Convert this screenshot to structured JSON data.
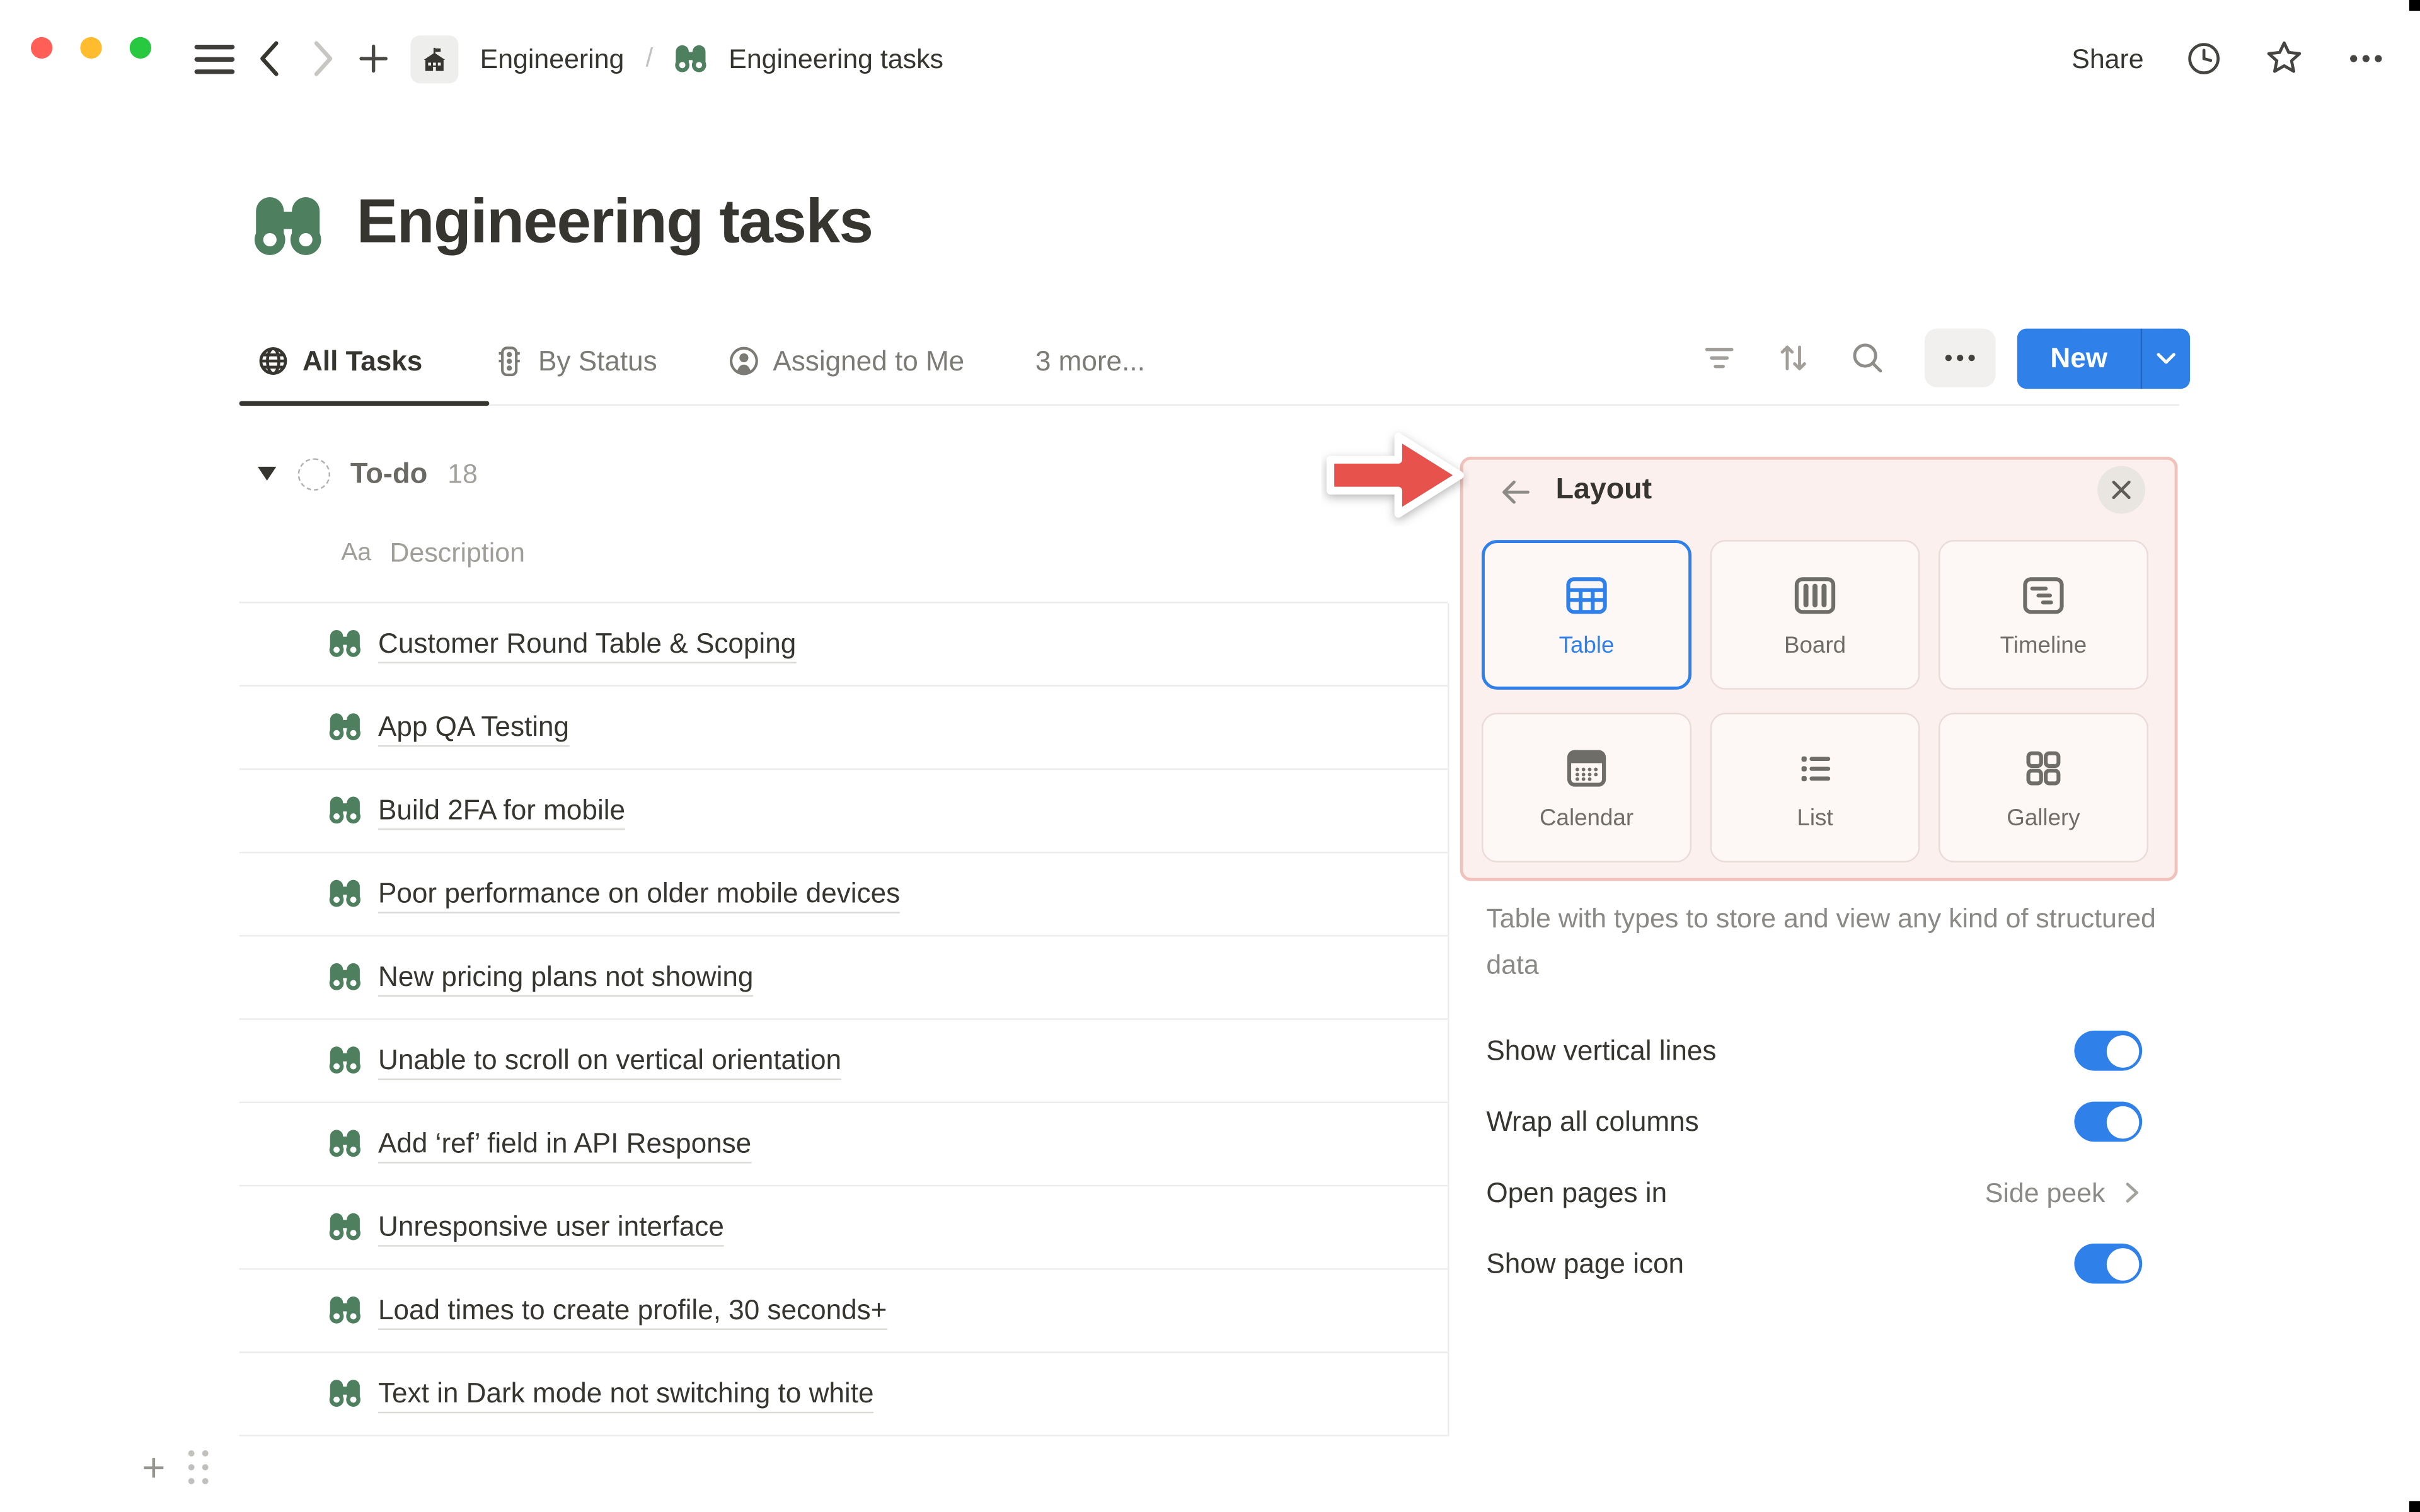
{
  "window": {
    "traffic_lights": {
      "close": "#ff5f57",
      "minimize": "#febc2e",
      "zoom": "#28c840"
    },
    "topbar": {
      "breadcrumb": {
        "workspace": "Engineering",
        "separator": "/",
        "page": "Engineering tasks"
      },
      "share_label": "Share",
      "action_icons": [
        "clock-icon",
        "star-icon",
        "more-icon"
      ]
    },
    "corner_artifacts": true
  },
  "page": {
    "icon": "binoculars-icon",
    "title": "Engineering tasks"
  },
  "views": {
    "tabs": [
      {
        "label": "All Tasks",
        "icon": "globe-icon",
        "active": true
      },
      {
        "label": "By Status",
        "icon": "status-icon",
        "active": false
      },
      {
        "label": "Assigned to Me",
        "icon": "person-icon",
        "active": false
      },
      {
        "label": "3 more...",
        "icon": null,
        "active": false
      }
    ],
    "toolbar_icons": [
      "filter-icon",
      "sort-icon",
      "search-icon",
      "more-icon"
    ],
    "new_button": "New"
  },
  "table": {
    "group": {
      "name": "To-do",
      "count": "18"
    },
    "column": {
      "type": "Aa",
      "label": "Description"
    },
    "rows": [
      "Customer Round Table & Scoping",
      "App QA Testing",
      "Build 2FA for mobile",
      "Poor performance on older mobile devices",
      "New pricing plans not showing",
      "Unable to scroll on vertical orientation",
      "Add ‘ref’ field in API Response",
      "Unresponsive user interface",
      "Load times to create profile, 30 seconds+",
      "Text in Dark mode not switching to white"
    ]
  },
  "layout_panel": {
    "title": "Layout",
    "options": [
      {
        "label": "Table",
        "icon": "table-icon",
        "selected": true
      },
      {
        "label": "Board",
        "icon": "board-icon",
        "selected": false
      },
      {
        "label": "Timeline",
        "icon": "timeline-icon",
        "selected": false
      },
      {
        "label": "Calendar",
        "icon": "calendar-icon",
        "selected": false
      },
      {
        "label": "List",
        "icon": "list-icon",
        "selected": false
      },
      {
        "label": "Gallery",
        "icon": "gallery-icon",
        "selected": false
      }
    ],
    "description": "Table with types to store and view any kind of structured data",
    "settings": [
      {
        "label": "Show vertical lines",
        "control": "toggle",
        "value": true
      },
      {
        "label": "Wrap all columns",
        "control": "toggle",
        "value": true
      },
      {
        "label": "Open pages in",
        "control": "link",
        "value": "Side peek"
      },
      {
        "label": "Show page icon",
        "control": "toggle",
        "value": true
      }
    ]
  },
  "colors": {
    "accent_blue": "#2f80e8",
    "icon_green": "#4e7f5e",
    "highlight_bg": "#fcf0ee",
    "highlight_border": "#f1c2bb",
    "annotation_red": "#e8524c",
    "text_dark": "#37352f",
    "text_gray": "#8b8985"
  }
}
